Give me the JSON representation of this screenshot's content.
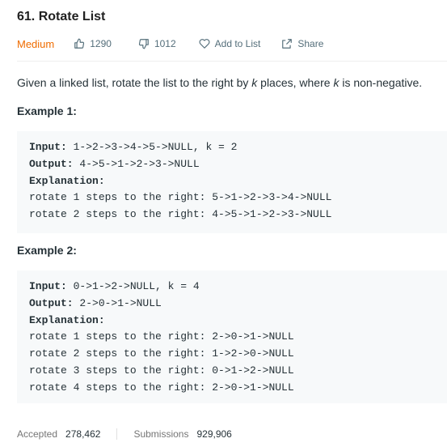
{
  "problem": {
    "title": "61. Rotate List",
    "difficulty": "Medium",
    "likes": "1290",
    "dislikes": "1012",
    "add_to_list": "Add to List",
    "share": "Share"
  },
  "description": {
    "part1": "Given a linked list, rotate the list to the right by ",
    "k1": "k",
    "part2": " places, where ",
    "k2": "k",
    "part3": " is non-negative."
  },
  "examples": [
    {
      "title": "Example 1:",
      "input_label": "Input:",
      "input": " 1->2->3->4->5->NULL, k = 2",
      "output_label": "Output:",
      "output": " 4->5->1->2->3->NULL",
      "explanation_label": "Explanation:",
      "lines": [
        "rotate 1 steps to the right: 5->1->2->3->4->NULL",
        "rotate 2 steps to the right: 4->5->1->2->3->NULL"
      ]
    },
    {
      "title": "Example 2:",
      "input_label": "Input:",
      "input": " 0->1->2->NULL, k = 4",
      "output_label": "Output:",
      "output": " 2->0->1->NULL",
      "explanation_label": "Explanation:",
      "lines": [
        "rotate 1 steps to the right: 2->0->1->NULL",
        "rotate 2 steps to the right: 1->2->0->NULL",
        "rotate 3 steps to the right: 0->1->2->NULL",
        "rotate 4 steps to the right: 2->0->1->NULL"
      ]
    }
  ],
  "stats": {
    "accepted_label": "Accepted",
    "accepted_value": "278,462",
    "submissions_label": "Submissions",
    "submissions_value": "929,906"
  },
  "colors": {
    "difficulty": "#ef6c00",
    "code_bg": "#f7f9fa"
  }
}
